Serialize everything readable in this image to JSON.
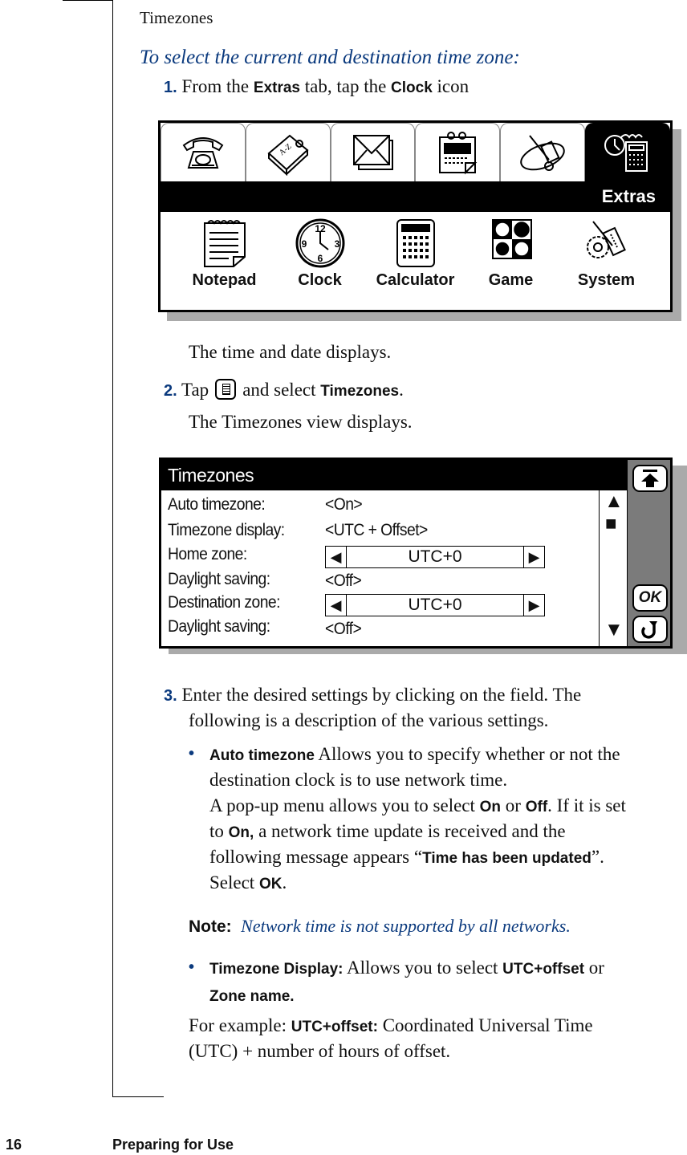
{
  "section_heading": "Timezones",
  "procedure_heading": "To select the current and destination time zone:",
  "steps": [
    {
      "number": "1.",
      "parts": [
        "From the ",
        "Extras",
        " tab, tap the ",
        "Clock",
        " icon"
      ]
    },
    {
      "number": "2.",
      "parts": [
        "Tap",
        "and select ",
        "Timezones",
        "."
      ],
      "menu_icon": "menu-key-icon"
    },
    {
      "number": "3.",
      "lines": [
        "Enter the desired settings by clicking on the field. The",
        "following is a description of the various settings."
      ]
    }
  ],
  "after_step1": "The time and date displays.",
  "after_step2": "The Timezones view displays.",
  "extras_screen": {
    "tabs": [
      {
        "icon": "telephone-icon",
        "active": false
      },
      {
        "icon": "address-book-icon",
        "active": false
      },
      {
        "icon": "envelope-icon",
        "active": false
      },
      {
        "icon": "calendar-icon",
        "active": false
      },
      {
        "icon": "phone-tools-icon",
        "active": false
      },
      {
        "icon": "extras-icon",
        "active": true
      }
    ],
    "tab_title": "Extras",
    "apps": [
      {
        "label": "Notepad",
        "icon": "notepad-icon"
      },
      {
        "label": "Clock",
        "icon": "clock-icon"
      },
      {
        "label": "Calculator",
        "icon": "calculator-icon"
      },
      {
        "label": "Game",
        "icon": "game-icon"
      },
      {
        "label": "System",
        "icon": "system-icon"
      }
    ]
  },
  "timezones_screen": {
    "title": "Timezones",
    "rows": [
      {
        "label": "Auto timezone:",
        "value": "<On>",
        "type": "toggle"
      },
      {
        "label": "Timezone display:",
        "value": "<UTC + Offset>",
        "type": "toggle"
      },
      {
        "label": "Home zone:",
        "value": "UTC+0",
        "type": "spinner"
      },
      {
        "label": "Daylight saving:",
        "value": "<Off>",
        "type": "toggle"
      },
      {
        "label": "Destination zone:",
        "value": "UTC+0",
        "type": "spinner"
      },
      {
        "label": "Daylight saving:",
        "value": "<Off>",
        "type": "toggle"
      }
    ],
    "side_buttons": {
      "top": "scroll-top-icon",
      "ok": "OK",
      "back": "back-icon"
    },
    "scroll": {
      "up": "▲",
      "thumb": "■",
      "down": "▼"
    },
    "spin_left": "◀",
    "spin_right": "▶"
  },
  "bullets": [
    {
      "term": "Auto timezone",
      "text_lines": [
        " Allows you to specify whether or not the",
        "destination clock is to use network time."
      ],
      "extra": {
        "line1": [
          "A pop-up menu allows you to select ",
          "On",
          " or ",
          "Off",
          ". If it is set"
        ],
        "line2": [
          "to ",
          "On,",
          " a network time update is received and the"
        ],
        "line3": [
          "following message appears “",
          "Time has been updated",
          "”."
        ],
        "line4": [
          "Select ",
          "OK",
          "."
        ]
      }
    },
    {
      "term": "Timezone Display:",
      "text_lines": [
        " Allows you to select ",
        "UTC+offset",
        " or",
        "Zone name."
      ]
    }
  ],
  "note": {
    "label": "Note:",
    "text": "Network time is not supported by all networks."
  },
  "example": {
    "line1": [
      "For example: ",
      "UTC+offset:",
      " Coordinated Universal Time"
    ],
    "line2": "(UTC) + number of hours of offset."
  },
  "footer": {
    "page_number": "16",
    "chapter": "Preparing for Use"
  },
  "colors": {
    "accent_blue": "#0b3a7e",
    "panel_gray": "#7b7b7b",
    "shadow_gray": "#aaaaaa"
  }
}
